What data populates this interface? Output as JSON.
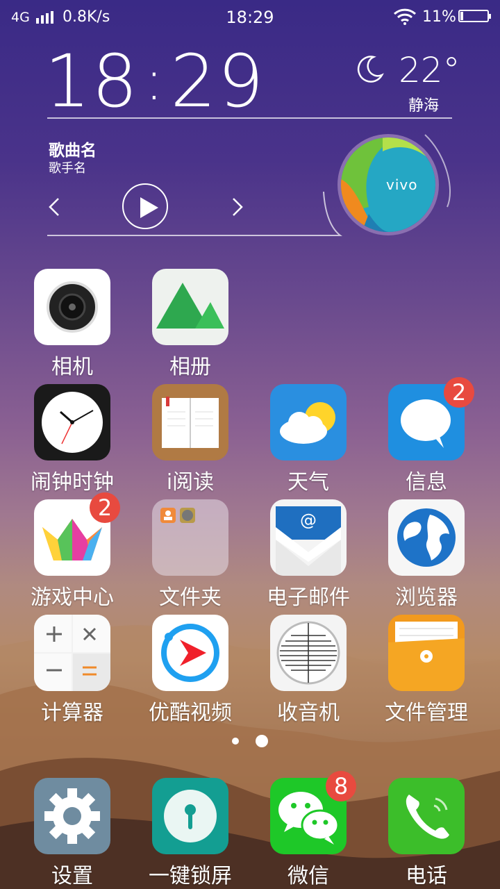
{
  "status_bar": {
    "network": "4G",
    "speed": "0.8K/s",
    "time": "18:29",
    "battery": "11%",
    "battery_level": 0.11
  },
  "clock_widget": {
    "hour": "18",
    "minute": "29",
    "temperature": "22°",
    "city": "静海",
    "weather_icon": "moon-icon"
  },
  "music_widget": {
    "song": "歌曲名",
    "artist": "歌手名",
    "disc_label": "vivo"
  },
  "apps": {
    "camera": "相机",
    "album": "相册",
    "alarm": "闹钟时钟",
    "ireader": "i阅读",
    "weather": "天气",
    "messages": "信息",
    "messages_badge": "2",
    "game_center": "游戏中心",
    "game_center_badge": "2",
    "folder": "文件夹",
    "email": "电子邮件",
    "browser": "浏览器",
    "calculator": "计算器",
    "youku": "优酷视频",
    "radio": "收音机",
    "file_manager": "文件管理"
  },
  "dock": {
    "settings": "设置",
    "lock": "一键锁屏",
    "wechat": "微信",
    "wechat_badge": "8",
    "phone": "电话"
  },
  "pager": {
    "count": 2,
    "active": 2
  }
}
